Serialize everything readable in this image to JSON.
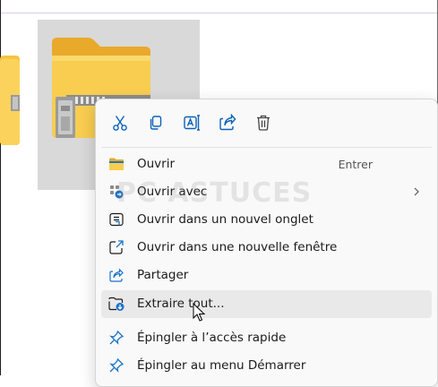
{
  "context_menu": {
    "quick_actions": [
      {
        "name": "cut",
        "icon": "scissors-icon"
      },
      {
        "name": "copy",
        "icon": "copy-icon"
      },
      {
        "name": "rename",
        "icon": "rename-icon"
      },
      {
        "name": "share",
        "icon": "share-icon"
      },
      {
        "name": "delete",
        "icon": "trash-icon"
      }
    ],
    "items": [
      {
        "label": "Ouvrir",
        "shortcut": "Entrer",
        "icon": "folder-icon"
      },
      {
        "label": "Ouvrir avec",
        "has_submenu": true,
        "icon": "open-with-icon"
      },
      {
        "label": "Ouvrir dans un nouvel onglet",
        "icon": "new-tab-icon"
      },
      {
        "label": "Ouvrir dans une nouvelle fenêtre",
        "icon": "new-window-icon"
      },
      {
        "label": "Partager",
        "icon": "share-icon"
      },
      {
        "label": "Extraire tout...",
        "icon": "extract-icon",
        "hovered": true
      },
      {
        "label": "Épingler à l’accès rapide",
        "icon": "pin-icon"
      },
      {
        "label": "Épingler au menu Démarrer",
        "icon": "pin-icon"
      }
    ]
  },
  "watermark": {
    "text": "PC ASTUCES"
  },
  "colors": {
    "accent": "#0067c0",
    "folder": "#f7c94b",
    "hover": "#e9e9e9"
  }
}
